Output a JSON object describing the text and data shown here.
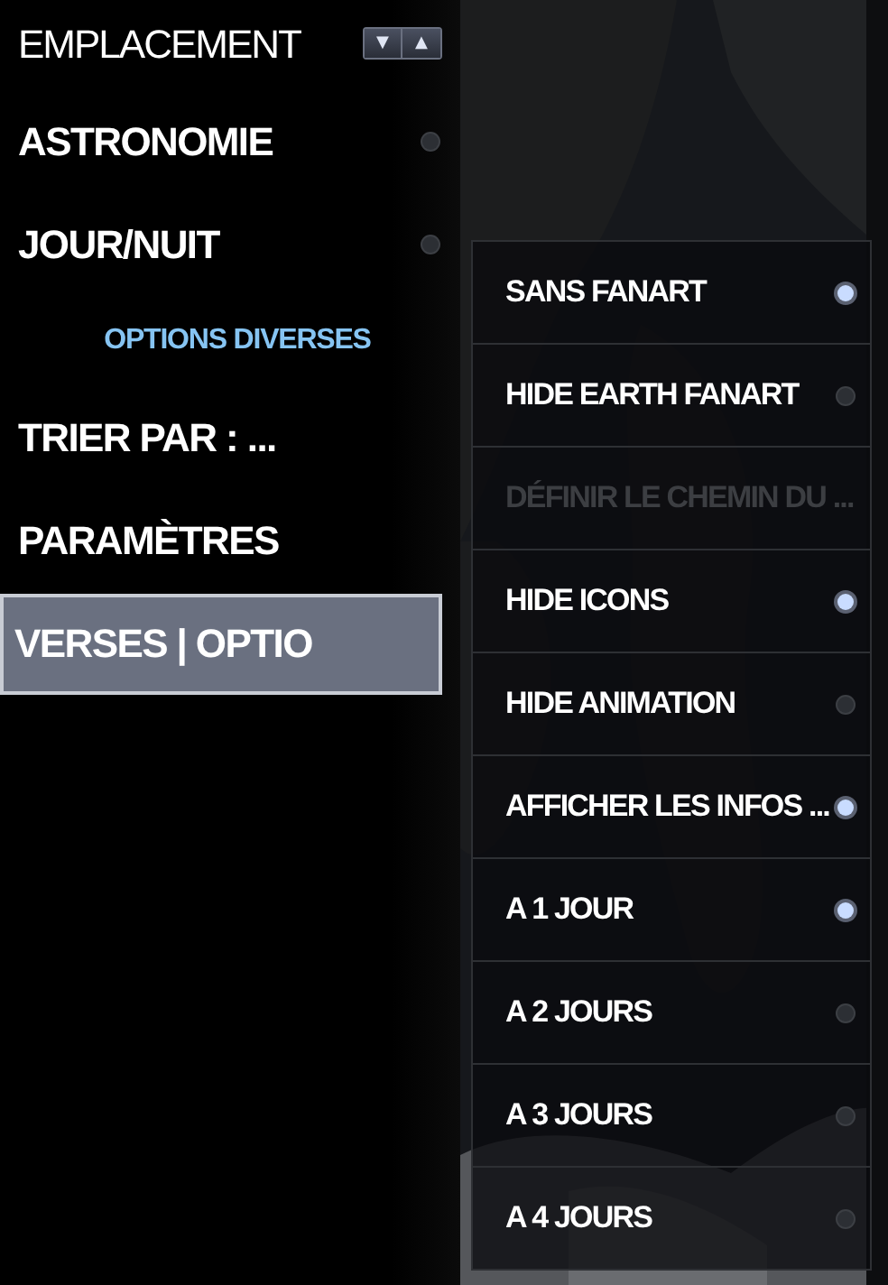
{
  "main_menu": [
    {
      "kind": "spinner",
      "label": "EMPLACEMENT",
      "selected": false,
      "buttons": [
        "▼",
        "▲"
      ]
    },
    {
      "kind": "toggle",
      "label": "ASTRONOMIE",
      "selected": false,
      "on": false
    },
    {
      "kind": "toggle",
      "label": "JOUR/NUIT",
      "selected": false,
      "on": false
    },
    {
      "kind": "header",
      "label": "OPTIONS DIVERSES"
    },
    {
      "kind": "plain",
      "label": "TRIER PAR : ...",
      "selected": false
    },
    {
      "kind": "plain",
      "label": "PARAMÈTRES",
      "selected": false
    },
    {
      "kind": "plain",
      "label": "VERSES | OPTIO",
      "selected": true
    }
  ],
  "submenu": [
    {
      "label": "SANS FANART",
      "disabled": false,
      "on": true
    },
    {
      "label": "HIDE EARTH FANART",
      "disabled": false,
      "on": false
    },
    {
      "label": "DÉFINIR LE CHEMIN DU ...",
      "disabled": true
    },
    {
      "label": "HIDE ICONS",
      "disabled": false,
      "on": true
    },
    {
      "label": "HIDE ANIMATION",
      "disabled": false,
      "on": false
    },
    {
      "label": "AFFICHER LES INFOS ...",
      "disabled": false,
      "on": true
    },
    {
      "label": "A 1 JOUR",
      "disabled": false,
      "on": true
    },
    {
      "label": "A 2 JOURS",
      "disabled": false,
      "on": false
    },
    {
      "label": "A 3 JOURS",
      "disabled": false,
      "on": false
    },
    {
      "label": "A 4 JOURS",
      "disabled": false,
      "on": false
    }
  ]
}
